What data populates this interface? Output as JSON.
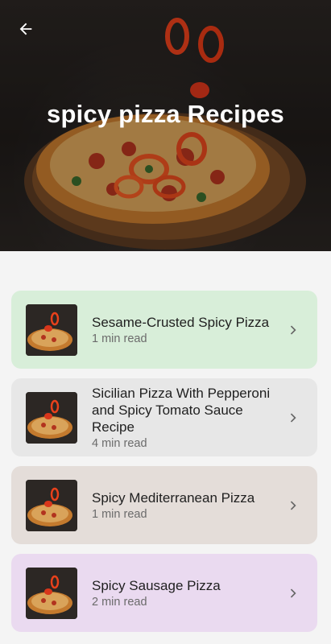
{
  "header": {
    "title": "spicy pizza Recipes",
    "back_icon": "arrow-left-icon"
  },
  "recipes": [
    {
      "title": "Sesame-Crusted Spicy Pizza",
      "meta": "1 min read",
      "bg": "#d8eed9"
    },
    {
      "title": "Sicilian Pizza With Pepperoni and Spicy Tomato Sauce Recipe",
      "meta": "4 min read",
      "bg": "#e7e7e7"
    },
    {
      "title": "Spicy Mediterranean Pizza",
      "meta": "1 min read",
      "bg": "#e4ddd9"
    },
    {
      "title": "Spicy Sausage Pizza",
      "meta": "2 min read",
      "bg": "#eadaf0"
    }
  ],
  "colors": {
    "page_bg": "#f4f4f4",
    "chevron": "#666666"
  }
}
